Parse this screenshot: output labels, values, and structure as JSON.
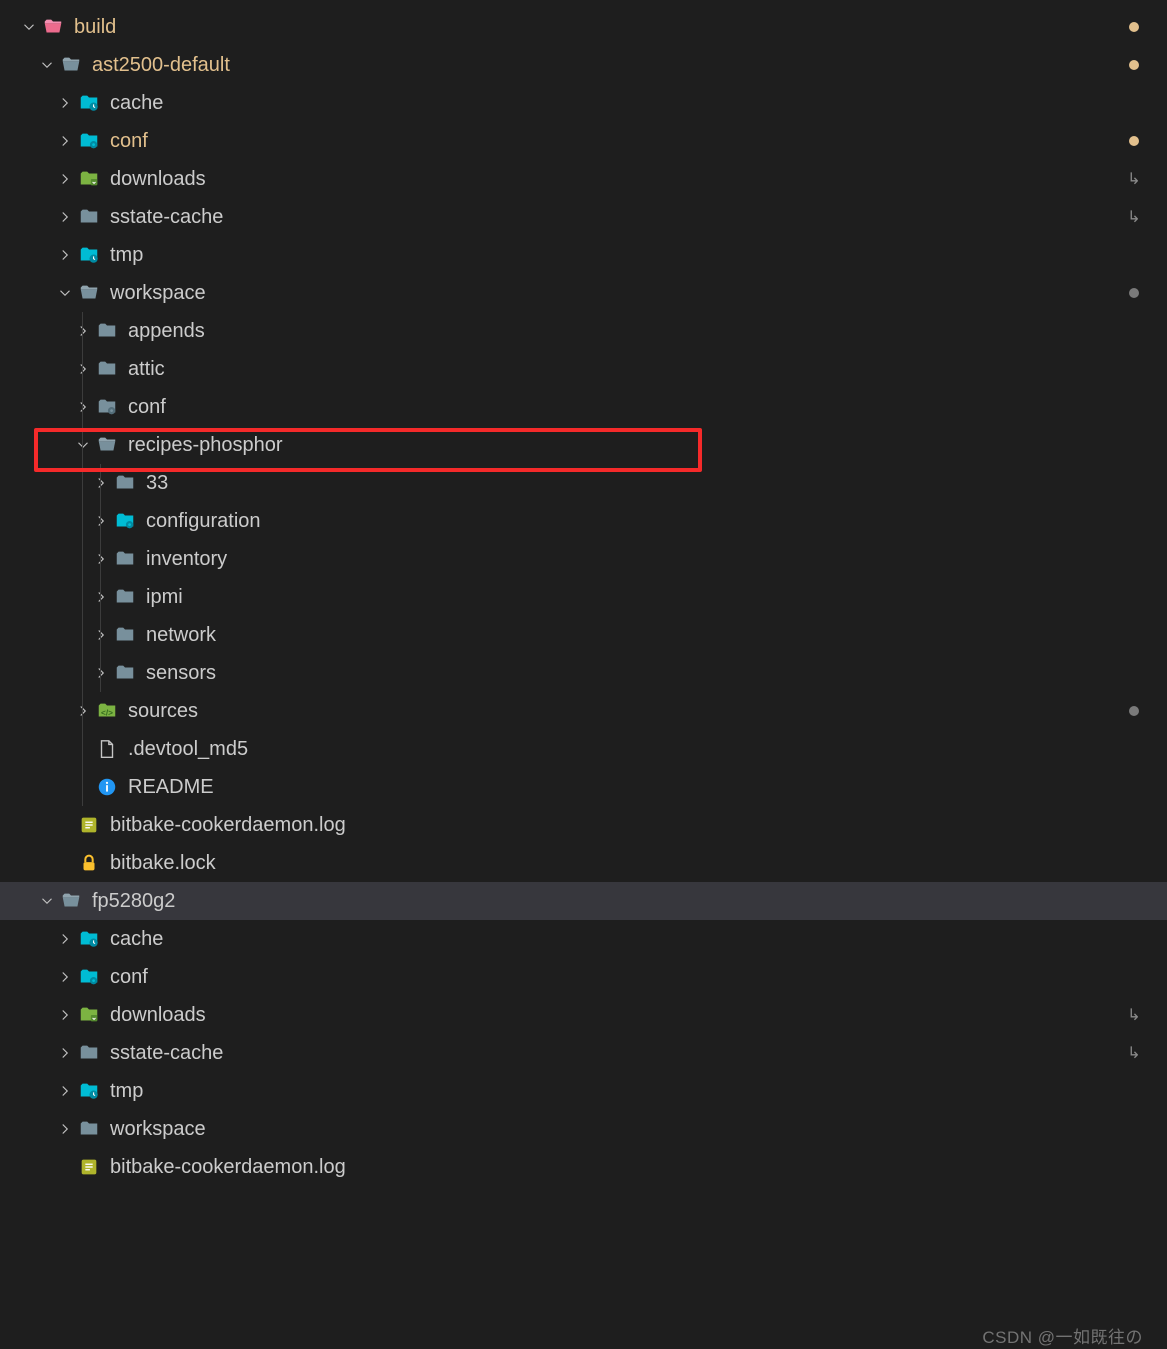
{
  "watermark": "CSDN @一如既往の",
  "tree": [
    {
      "depth": 1,
      "chevron": "down",
      "icon": "folder-pink-open",
      "label": "build",
      "modified": true,
      "status": "dot"
    },
    {
      "depth": 2,
      "chevron": "down",
      "icon": "folder-open",
      "label": "ast2500-default",
      "modified": true,
      "status": "dot"
    },
    {
      "depth": 3,
      "chevron": "right",
      "icon": "folder-teal-clock",
      "label": "cache"
    },
    {
      "depth": 3,
      "chevron": "right",
      "icon": "folder-teal-gear",
      "label": "conf",
      "modified": true,
      "status": "dot"
    },
    {
      "depth": 3,
      "chevron": "right",
      "icon": "folder-green-down",
      "label": "downloads",
      "status": "sym"
    },
    {
      "depth": 3,
      "chevron": "right",
      "icon": "folder-gray",
      "label": "sstate-cache",
      "status": "sym"
    },
    {
      "depth": 3,
      "chevron": "right",
      "icon": "folder-teal-clock",
      "label": "tmp"
    },
    {
      "depth": 3,
      "chevron": "down",
      "icon": "folder-open",
      "label": "workspace",
      "status": "gray-dot"
    },
    {
      "depth": 4,
      "chevron": "right",
      "icon": "folder-gray",
      "label": "appends"
    },
    {
      "depth": 4,
      "chevron": "right",
      "icon": "folder-gray",
      "label": "attic"
    },
    {
      "depth": 4,
      "chevron": "right",
      "icon": "folder-gray-gear",
      "label": "conf"
    },
    {
      "depth": 4,
      "chevron": "down",
      "icon": "folder-open-gray",
      "label": "recipes-phosphor",
      "highlight": true
    },
    {
      "depth": 5,
      "chevron": "right",
      "icon": "folder-gray",
      "label": "33"
    },
    {
      "depth": 5,
      "chevron": "right",
      "icon": "folder-teal-gear",
      "label": "configuration"
    },
    {
      "depth": 5,
      "chevron": "right",
      "icon": "folder-gray",
      "label": "inventory"
    },
    {
      "depth": 5,
      "chevron": "right",
      "icon": "folder-gray",
      "label": "ipmi"
    },
    {
      "depth": 5,
      "chevron": "right",
      "icon": "folder-gray",
      "label": "network"
    },
    {
      "depth": 5,
      "chevron": "right",
      "icon": "folder-gray",
      "label": "sensors"
    },
    {
      "depth": 4,
      "chevron": "right",
      "icon": "folder-green-code",
      "label": "sources",
      "status": "gray-dot"
    },
    {
      "depth": 4,
      "chevron": "none",
      "icon": "file",
      "label": ".devtool_md5"
    },
    {
      "depth": 4,
      "chevron": "none",
      "icon": "info",
      "label": "README"
    },
    {
      "depth": 3,
      "chevron": "none",
      "icon": "log",
      "label": "bitbake-cookerdaemon.log"
    },
    {
      "depth": 3,
      "chevron": "none",
      "icon": "lock",
      "label": "bitbake.lock"
    },
    {
      "depth": 2,
      "chevron": "down",
      "icon": "folder-open",
      "label": "fp5280g2",
      "selected": true
    },
    {
      "depth": 3,
      "chevron": "right",
      "icon": "folder-teal-clock",
      "label": "cache"
    },
    {
      "depth": 3,
      "chevron": "right",
      "icon": "folder-teal-gear",
      "label": "conf"
    },
    {
      "depth": 3,
      "chevron": "right",
      "icon": "folder-green-down",
      "label": "downloads",
      "status": "sym"
    },
    {
      "depth": 3,
      "chevron": "right",
      "icon": "folder-gray",
      "label": "sstate-cache",
      "status": "sym"
    },
    {
      "depth": 3,
      "chevron": "right",
      "icon": "folder-teal-clock",
      "label": "tmp"
    },
    {
      "depth": 3,
      "chevron": "right",
      "icon": "folder-gray",
      "label": "workspace"
    },
    {
      "depth": 3,
      "chevron": "none",
      "icon": "log",
      "label": "bitbake-cookerdaemon.log"
    }
  ]
}
